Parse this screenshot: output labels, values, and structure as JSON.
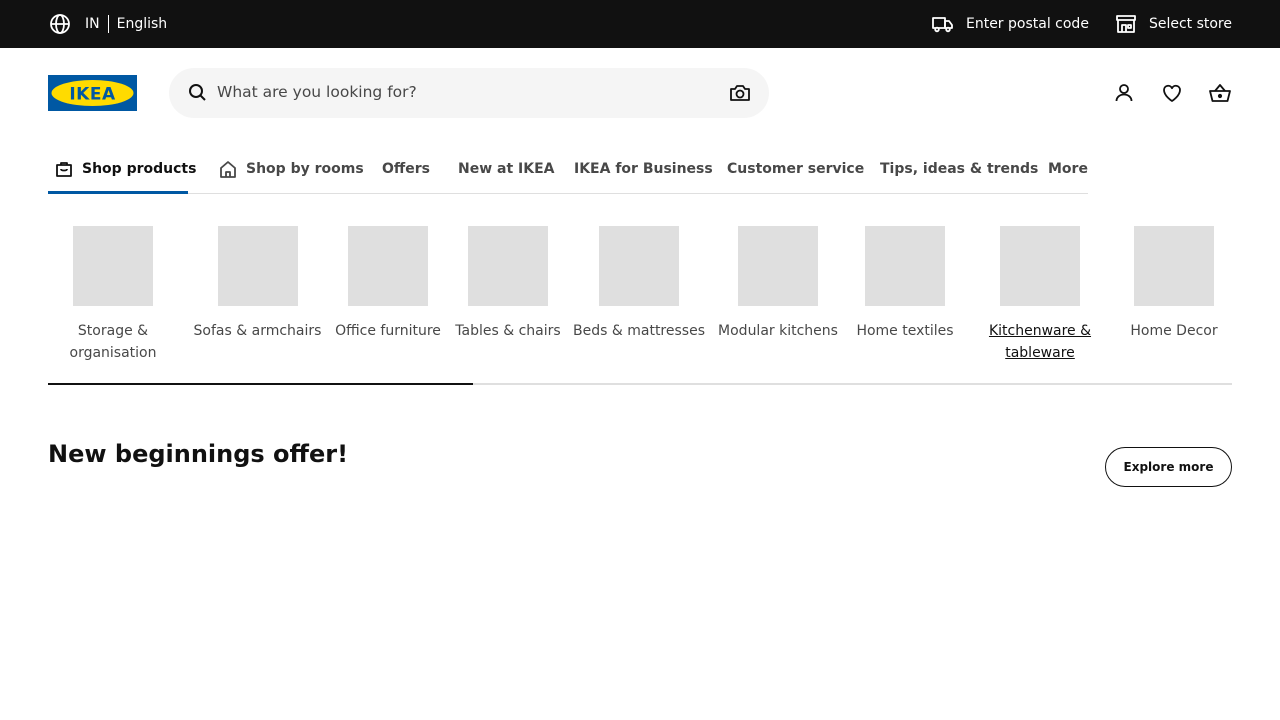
{
  "topbar": {
    "country": "IN",
    "language": "English",
    "postal_label": "Enter postal code",
    "store_label": "Select store",
    "globe_icon": "globe-icon",
    "truck_icon": "delivery-truck-icon",
    "store_icon": "store-icon"
  },
  "header": {
    "logo_text": "IKEA",
    "search_placeholder": "What are you looking for?",
    "icons": [
      "search-icon",
      "camera-icon",
      "user-icon",
      "heart-icon",
      "basket-icon"
    ]
  },
  "nav": {
    "tabs": [
      {
        "label": "Shop products",
        "icon": "shopping-bag-icon",
        "active": true
      },
      {
        "label": "Shop by rooms",
        "icon": "house-icon",
        "active": false
      },
      {
        "label": "Offers",
        "active": false
      },
      {
        "label": "New at IKEA",
        "active": false
      },
      {
        "label": "IKEA for Business",
        "active": false
      },
      {
        "label": "Customer service",
        "active": false
      },
      {
        "label": "Tips, ideas & trends",
        "active": false
      },
      {
        "label": "More",
        "active": false
      }
    ]
  },
  "categories": [
    {
      "label": "Storage & organisation"
    },
    {
      "label": "Sofas & armchairs"
    },
    {
      "label": "Office furniture"
    },
    {
      "label": "Tables & chairs"
    },
    {
      "label": "Beds & mattresses"
    },
    {
      "label": "Modular kitchens"
    },
    {
      "label": "Home textiles"
    },
    {
      "label": "Kitchenware & tableware"
    },
    {
      "label": "Home Decor"
    }
  ],
  "offer": {
    "title": "New beginnings offer!",
    "button_label": "Explore more"
  },
  "colors": {
    "topbar_bg": "#111111",
    "accent_blue": "#0058a3",
    "logo_blue": "#0058a3",
    "logo_yellow": "#ffdb00",
    "search_bg": "#f5f5f5",
    "placeholder_bg": "#dfdfdf"
  }
}
